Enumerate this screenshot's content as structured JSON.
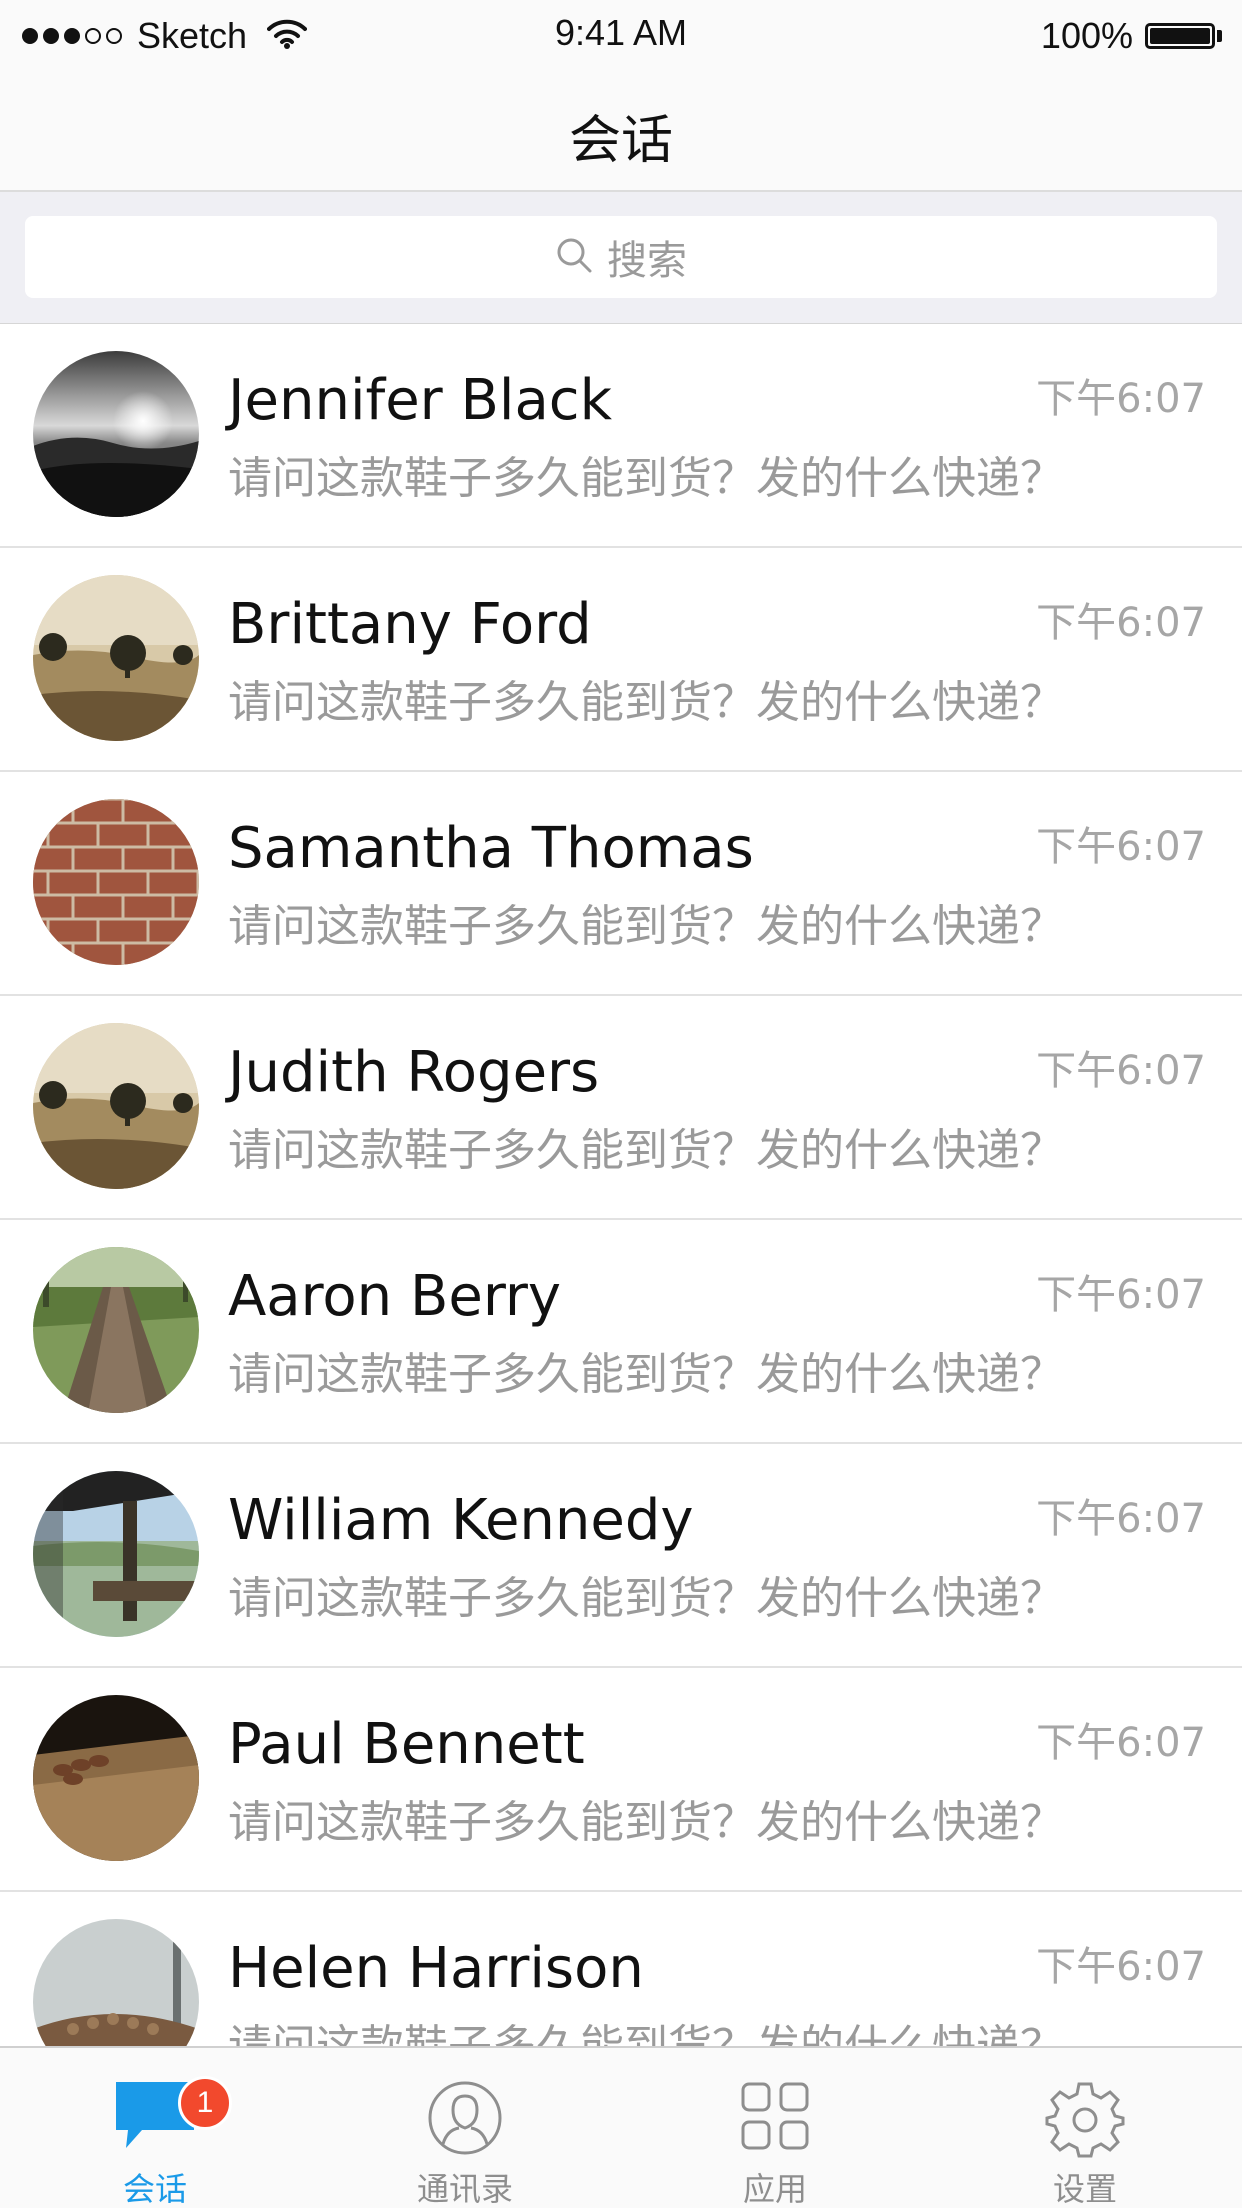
{
  "status_bar": {
    "carrier": "Sketch",
    "time": "9:41 AM",
    "battery": "100%"
  },
  "nav": {
    "title": "会话"
  },
  "search": {
    "placeholder": "搜索"
  },
  "conversations": [
    {
      "name": "Jennifer Black",
      "time": "下午6:07",
      "message": "请问这款鞋子多久能到货？发的什么快递？",
      "avatar": "sunset-hills"
    },
    {
      "name": "Brittany Ford",
      "time": "下午6:07",
      "message": "请问这款鞋子多久能到货？发的什么快递？",
      "avatar": "sepia-field-trees"
    },
    {
      "name": "Samantha Thomas",
      "time": "下午6:07",
      "message": "请问这款鞋子多久能到货？发的什么快递？",
      "avatar": "brick-wall"
    },
    {
      "name": "Judith Rogers",
      "time": "下午6:07",
      "message": "请问这款鞋子多久能到货？发的什么快递？",
      "avatar": "sepia-field-trees"
    },
    {
      "name": "Aaron Berry",
      "time": "下午6:07",
      "message": "请问这款鞋子多久能到货？发的什么快递？",
      "avatar": "forest-path"
    },
    {
      "name": "William Kennedy",
      "time": "下午6:07",
      "message": "请问这款鞋子多久能到货？发的什么快递？",
      "avatar": "lake-pier"
    },
    {
      "name": "Paul Bennett",
      "time": "下午6:07",
      "message": "请问这款鞋子多久能到货？发的什么快递？",
      "avatar": "wood-table"
    },
    {
      "name": "Helen Harrison",
      "time": "下午6:07",
      "message": "请问这款鞋子多久能到货？发的什么快递？",
      "avatar": "foggy-logs"
    }
  ],
  "tab_bar": {
    "tabs": [
      {
        "label": "会话",
        "icon": "chat-bubble-icon",
        "active": true,
        "badge": "1"
      },
      {
        "label": "通讯录",
        "icon": "contacts-icon",
        "active": false
      },
      {
        "label": "应用",
        "icon": "apps-grid-icon",
        "active": false
      },
      {
        "label": "设置",
        "icon": "settings-gear-icon",
        "active": false
      }
    ]
  },
  "colors": {
    "accent": "#1a9ae8",
    "badge": "#f2492d",
    "secondary_text": "#9a9a9a"
  }
}
